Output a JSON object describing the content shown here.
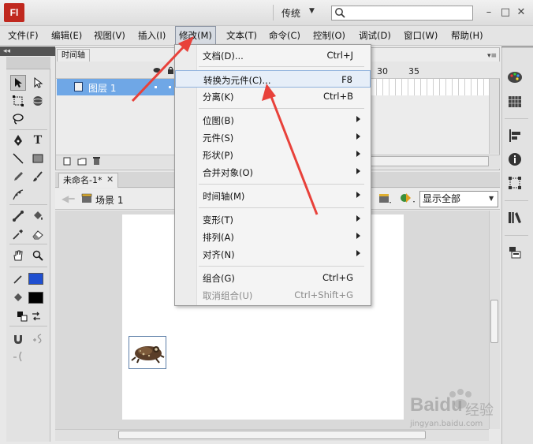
{
  "titlebar": {
    "logo": "Fl",
    "workspace": "传统",
    "search_placeholder": "",
    "window_buttons": [
      "–",
      "□",
      "✕"
    ]
  },
  "menubar": {
    "items": [
      {
        "label": "文件(F)"
      },
      {
        "label": "编辑(E)"
      },
      {
        "label": "视图(V)"
      },
      {
        "label": "插入(I)"
      },
      {
        "label": "修改(M)"
      },
      {
        "label": "文本(T)"
      },
      {
        "label": "命令(C)"
      },
      {
        "label": "控制(O)"
      },
      {
        "label": "调试(D)"
      },
      {
        "label": "窗口(W)"
      },
      {
        "label": "帮助(H)"
      }
    ],
    "active_index": 4
  },
  "timeline": {
    "tab": "时间轴",
    "layer_name": "图层 1",
    "frame_numbers": [
      "30",
      "35"
    ]
  },
  "document": {
    "tab": "未命名-1*",
    "tab_close": "✕",
    "scene_label": "场景 1",
    "zoom_value": "显示全部"
  },
  "context_menu": {
    "items": [
      {
        "label": "文档(D)...",
        "shortcut": "Ctrl+J",
        "submenu": false
      },
      {
        "label": "转换为元件(C)...",
        "shortcut": "F8",
        "submenu": false,
        "highlighted": true
      },
      {
        "label": "分离(K)",
        "shortcut": "Ctrl+B",
        "submenu": false
      },
      {
        "label": "位图(B)",
        "shortcut": "",
        "submenu": true
      },
      {
        "label": "元件(S)",
        "shortcut": "",
        "submenu": true
      },
      {
        "label": "形状(P)",
        "shortcut": "",
        "submenu": true
      },
      {
        "label": "合并对象(O)",
        "shortcut": "",
        "submenu": true
      },
      {
        "label": "时间轴(M)",
        "shortcut": "",
        "submenu": true
      },
      {
        "label": "变形(T)",
        "shortcut": "",
        "submenu": true
      },
      {
        "label": "排列(A)",
        "shortcut": "",
        "submenu": true
      },
      {
        "label": "对齐(N)",
        "shortcut": "",
        "submenu": true
      },
      {
        "label": "组合(G)",
        "shortcut": "Ctrl+G",
        "submenu": false
      },
      {
        "label": "取消组合(U)",
        "shortcut": "Ctrl+Shift+G",
        "submenu": false,
        "disabled": true
      }
    ]
  },
  "watermark": {
    "brand": "Baidu",
    "text": "经验",
    "url": "jingyan.baidu.com"
  },
  "colors": {
    "accent_red": "#e8413a",
    "layer_selected": "#6fa7e6",
    "stroke_color": "#1f4fd0",
    "fill_color": "#000000"
  }
}
